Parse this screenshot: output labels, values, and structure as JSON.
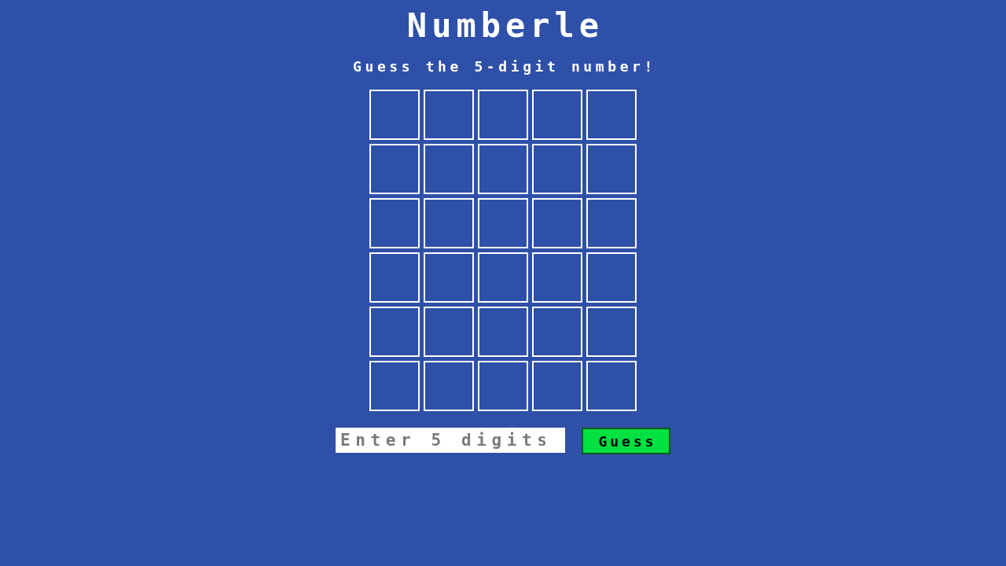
{
  "title": "Numberle",
  "subtitle": "Guess the 5-digit number!",
  "board": {
    "rows": [
      {
        "cells": [
          {
            "kind": "empty"
          },
          {
            "kind": "empty"
          },
          {
            "kind": "empty"
          },
          {
            "kind": "empty"
          },
          {
            "kind": "empty"
          }
        ]
      },
      {
        "cells": [
          {
            "kind": "empty"
          },
          {
            "kind": "empty"
          },
          {
            "kind": "empty"
          },
          {
            "kind": "empty"
          },
          {
            "kind": "empty"
          }
        ]
      },
      {
        "cells": [
          {
            "kind": "empty"
          },
          {
            "kind": "empty"
          },
          {
            "kind": "empty"
          },
          {
            "kind": "empty"
          },
          {
            "kind": "empty"
          }
        ]
      },
      {
        "cells": [
          {
            "kind": "empty"
          },
          {
            "kind": "empty"
          },
          {
            "kind": "empty"
          },
          {
            "kind": "empty"
          },
          {
            "kind": "empty"
          }
        ]
      },
      {
        "cells": [
          {
            "kind": "empty"
          },
          {
            "kind": "empty"
          },
          {
            "kind": "empty"
          },
          {
            "kind": "empty"
          },
          {
            "kind": "empty"
          }
        ]
      },
      {
        "cells": [
          {
            "kind": "empty"
          },
          {
            "kind": "empty"
          },
          {
            "kind": "empty"
          },
          {
            "kind": "empty"
          },
          {
            "kind": "empty"
          }
        ]
      }
    ]
  },
  "guess_input": {
    "placeholder": "Enter 5 digits"
  },
  "guess_button": {
    "label": "Guess"
  }
}
